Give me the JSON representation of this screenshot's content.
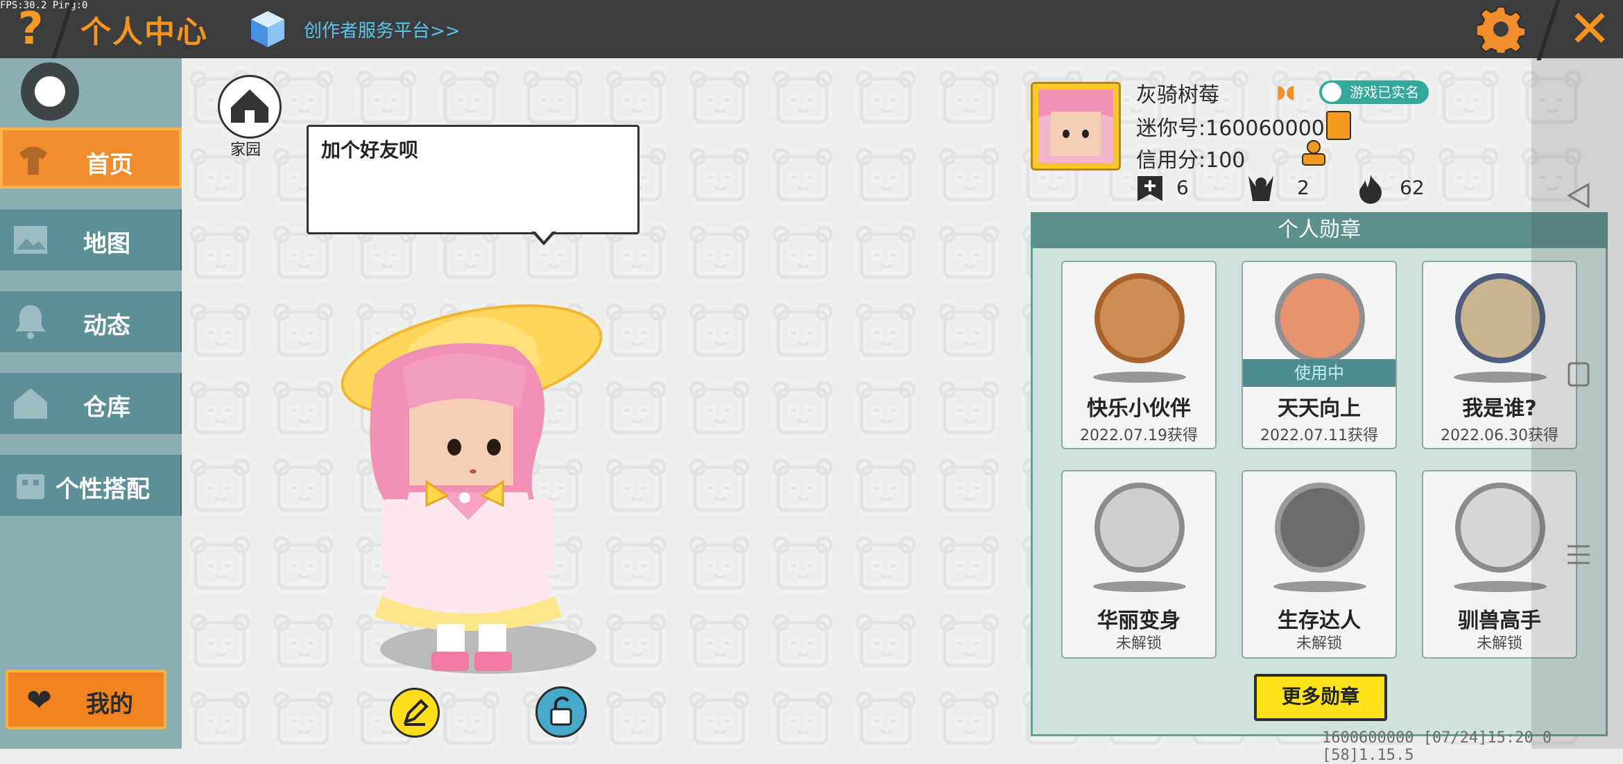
{
  "debug": {
    "fps": "FPS:30.2",
    "ping": "Ping:0"
  },
  "header": {
    "help_icon": "question-mark",
    "title": "个人中心",
    "creator_link": "创作者服务平台>>",
    "settings_icon": "gear",
    "close_icon": "x"
  },
  "sidebar": {
    "items": [
      {
        "label": "首页",
        "icon": "shirt-icon",
        "active": true
      },
      {
        "label": "地图",
        "icon": "map-icon",
        "active": false
      },
      {
        "label": "动态",
        "icon": "bell-icon",
        "active": false
      },
      {
        "label": "仓库",
        "icon": "house-icon",
        "active": false
      },
      {
        "label": "个性搭配",
        "icon": "outfit-icon",
        "active": false
      }
    ],
    "mine_button": "我的"
  },
  "home": {
    "label": "家园"
  },
  "speech_bubble": {
    "text": "加个好友呗"
  },
  "profile": {
    "name": "灰骑树莓",
    "verified_label": "游戏已实名",
    "mini_id": "迷你号:1600600000",
    "credit": "信用分:100",
    "stats": [
      {
        "icon": "add-friend-icon",
        "value": "6"
      },
      {
        "icon": "fans-icon",
        "value": "2"
      },
      {
        "icon": "fire-icon",
        "value": "62"
      }
    ]
  },
  "badges": {
    "title": "个人勋章",
    "items": [
      {
        "name": "快乐小伙伴",
        "date": "2022.07.19获得",
        "status": "unlocked",
        "color": "#c8773a"
      },
      {
        "name": "天天向上",
        "date": "2022.07.11获得",
        "status": "in_use",
        "in_use_label": "使用中",
        "color": "#9a9a9a"
      },
      {
        "name": "我是谁?",
        "date": "2022.06.30获得",
        "status": "unlocked",
        "color": "#5d6d92"
      },
      {
        "name": "华丽变身",
        "date": "未解锁",
        "status": "locked",
        "color": "#a8a8a8"
      },
      {
        "name": "生存达人",
        "date": "未解锁",
        "status": "locked",
        "color": "#a8a8a8"
      },
      {
        "name": "驯兽高手",
        "date": "未解锁",
        "status": "locked",
        "color": "#a8a8a8"
      }
    ],
    "more_button": "更多勋章"
  },
  "footer": {
    "text": "1600600000 [07/24]15:20 0 [58]1.15.5"
  },
  "colors": {
    "accent_orange": "#f08d2c",
    "teal": "#5d8f96",
    "yellow": "#ffe31a"
  }
}
